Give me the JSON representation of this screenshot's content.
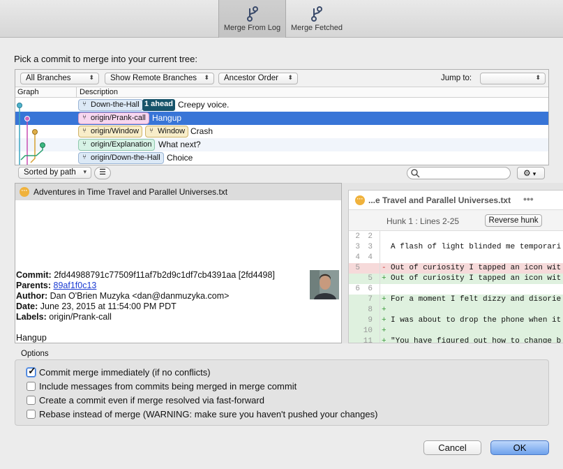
{
  "toolbar": {
    "merge_from_log": "Merge From Log",
    "merge_fetched": "Merge Fetched"
  },
  "prompt": "Pick a commit to merge into your current tree:",
  "filters": {
    "branches": "All Branches",
    "remote": "Show Remote Branches",
    "order": "Ancestor Order",
    "jump_to_label": "Jump to:",
    "jump_to_value": ""
  },
  "columns": {
    "graph": "Graph",
    "description": "Description"
  },
  "commits": [
    {
      "tags": [
        "Down-the-Hall"
      ],
      "ahead": "1 ahead",
      "message": "Creepy voice."
    },
    {
      "tags": [
        "origin/Prank-call"
      ],
      "message": "Hangup"
    },
    {
      "tags": [
        "origin/Window",
        "Window"
      ],
      "message": "Crash"
    },
    {
      "tags": [
        "origin/Explanation"
      ],
      "message": "What next?"
    },
    {
      "tags": [
        "origin/Down-the-Hall"
      ],
      "message": "Choice"
    }
  ],
  "lower": {
    "sort": "Sorted by path",
    "search_placeholder": ""
  },
  "files": [
    {
      "name": "Adventures in Time Travel and Parallel Universes.txt"
    }
  ],
  "details": {
    "commit_label": "Commit:",
    "commit_value": "2fd44988791c77509f11af7b2d9c1df7cb4391aa [2fd4498]",
    "parents_label": "Parents:",
    "parents_value": "89af1f0c13",
    "author_label": "Author:",
    "author_value": "Dan O'Brien Muzyka <dan@danmuzyka.com>",
    "date_label": "Date:",
    "date_value": "June 23, 2015 at 11:54:00 PM PDT",
    "labels_label": "Labels:",
    "labels_value": "origin/Prank-call",
    "message": "Hangup"
  },
  "diff": {
    "file_title": "...e Travel and Parallel Universes.txt",
    "hunk_label": "Hunk 1 : Lines 2-25",
    "reverse_button": "Reverse hunk",
    "lines": [
      {
        "old": "2",
        "new": "2",
        "sign": "",
        "text": "",
        "kind": "ctx"
      },
      {
        "old": "3",
        "new": "3",
        "sign": "",
        "text": "A flash of light blinded me temporari",
        "kind": "ctx"
      },
      {
        "old": "4",
        "new": "4",
        "sign": "",
        "text": "",
        "kind": "ctx"
      },
      {
        "old": "5",
        "new": "",
        "sign": "-",
        "text": "Out of curiosity I tapped an icon wit",
        "kind": "del"
      },
      {
        "old": "",
        "new": "5",
        "sign": "+",
        "text": "Out of curiosity I tapped an icon wit",
        "kind": "add"
      },
      {
        "old": "6",
        "new": "6",
        "sign": "",
        "text": "",
        "kind": "ctx"
      },
      {
        "old": "",
        "new": "7",
        "sign": "+",
        "text": "For a moment I felt dizzy and disorie",
        "kind": "add"
      },
      {
        "old": "",
        "new": "8",
        "sign": "+",
        "text": "",
        "kind": "add"
      },
      {
        "old": "",
        "new": "9",
        "sign": "+",
        "text": "I was about to drop the phone when it",
        "kind": "add"
      },
      {
        "old": "",
        "new": "10",
        "sign": "+",
        "text": "",
        "kind": "add"
      },
      {
        "old": "",
        "new": "11",
        "sign": "+",
        "text": "\"You have figured out how to change b",
        "kind": "add"
      }
    ]
  },
  "options": {
    "title": "Options",
    "items": [
      {
        "label": "Commit merge immediately (if no conflicts)",
        "checked": true
      },
      {
        "label": "Include messages from commits being merged in merge commit",
        "checked": false
      },
      {
        "label": "Create a commit even if merge resolved via fast-forward",
        "checked": false
      },
      {
        "label": "Rebase instead of merge (WARNING: make sure you haven't pushed your changes)",
        "checked": false
      }
    ]
  },
  "buttons": {
    "cancel": "Cancel",
    "ok": "OK"
  },
  "colors": {
    "selection": "#3875d7",
    "ahead_badge": "#16536a",
    "tag_local": "#dce9f6",
    "tag_pink": "#f6d6ef",
    "tag_yellow": "#f8edc9",
    "tag_green": "#d6f2e5",
    "diff_add": "#dff1df",
    "diff_del": "#f6dada"
  },
  "icons": {
    "merge": "branch-merge-icon",
    "branch_tag": "branch-icon",
    "gear": "gear-icon",
    "search": "search-icon",
    "list": "list-icon",
    "more": "ellipsis-icon"
  }
}
